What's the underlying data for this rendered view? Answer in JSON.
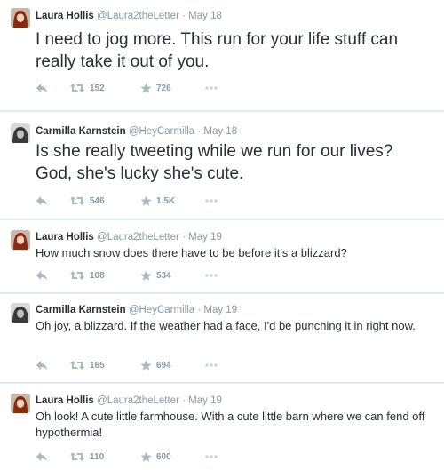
{
  "tweets": [
    {
      "name": "Laura Hollis",
      "handle": "@Laura2theLetter",
      "date": "May 18",
      "text": "I need to jog more. This run for your life stuff can really take it out of you.",
      "retweets": "152",
      "favorites": "726",
      "avatar": "laura-avatar"
    },
    {
      "name": "Carmilla Karnstein",
      "handle": "@HeyCarmilla",
      "date": "May 18",
      "text": "Is she really tweeting while we run for our lives? God, she's lucky she's cute.",
      "retweets": "546",
      "favorites": "1.5K",
      "avatar": "carmilla-avatar"
    },
    {
      "name": "Laura Hollis",
      "handle": "@Laura2theLetter",
      "date": "May 19",
      "text": "How much snow does there have to be before it's a blizzard?",
      "retweets": "108",
      "favorites": "534",
      "avatar": "laura-avatar"
    },
    {
      "name": "Carmilla Karnstein",
      "handle": "@HeyCarmilla",
      "date": "May 19",
      "text": "Oh joy, a blizzard. If the weather had a face, I'd be punching it in right now.",
      "retweets": "165",
      "favorites": "694",
      "avatar": "carmilla-avatar"
    },
    {
      "name": "Laura Hollis",
      "handle": "@Laura2theLetter",
      "date": "May 19",
      "text": "Oh look! A cute little farmhouse. With a cute little barn where we can fend off hypothermia!",
      "retweets": "110",
      "favorites": "600",
      "avatar": "laura-avatar"
    }
  ],
  "separator": "·",
  "icons": {
    "reply": "reply-icon",
    "retweet": "retweet-icon",
    "favorite": "star-icon",
    "more": "more-icon"
  },
  "colors": {
    "background": "#e6ecf0",
    "card": "#ffffff",
    "text": "#292f33",
    "muted": "#8899a6",
    "icon": "#aab8c2"
  }
}
